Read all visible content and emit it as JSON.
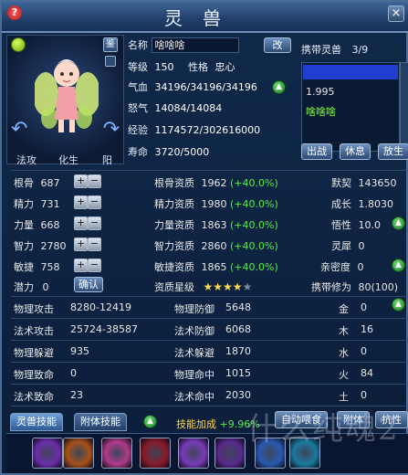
{
  "window": {
    "title": "灵兽"
  },
  "portrait": {
    "jian": "鉴",
    "labels": [
      "法攻",
      "化生",
      "阳"
    ]
  },
  "info": {
    "name_label": "名称",
    "name": "啥啥啥",
    "rename": "改",
    "level_label": "等级",
    "level": "150",
    "personality_label": "性格",
    "personality": "忠心",
    "hp_label": "气血",
    "hp": "34196/34196/34196",
    "rage_label": "怒气",
    "rage": "14084/14084",
    "exp_label": "经验",
    "exp": "1174572/302616000",
    "life_label": "寿命",
    "life": "3720/5000"
  },
  "carry": {
    "label": "携带灵兽",
    "count": "3/9",
    "items": [
      "1.995",
      "啥啥啥"
    ],
    "buttons": {
      "fight": "出战",
      "rest": "休息",
      "release": "放生"
    }
  },
  "stats": {
    "left": [
      {
        "label": "根骨",
        "value": "687"
      },
      {
        "label": "精力",
        "value": "731"
      },
      {
        "label": "力量",
        "value": "668"
      },
      {
        "label": "智力",
        "value": "2780"
      },
      {
        "label": "敏捷",
        "value": "758"
      }
    ],
    "aptitude": [
      {
        "label": "根骨资质",
        "value": "1962",
        "bonus": "(+40.0%)"
      },
      {
        "label": "精力资质",
        "value": "1980",
        "bonus": "(+40.0%)"
      },
      {
        "label": "力量资质",
        "value": "1863",
        "bonus": "(+40.0%)"
      },
      {
        "label": "智力资质",
        "value": "2860",
        "bonus": "(+40.0%)"
      },
      {
        "label": "敏捷资质",
        "value": "1865",
        "bonus": "(+40.0%)"
      }
    ],
    "right": [
      {
        "label": "默契",
        "value": "143650"
      },
      {
        "label": "成长",
        "value": "1.8030"
      },
      {
        "label": "悟性",
        "value": "10.0"
      },
      {
        "label": "灵犀",
        "value": "0"
      },
      {
        "label": "亲密度",
        "value": "0"
      }
    ],
    "potential_label": "潜力",
    "potential": "0",
    "confirm": "确认",
    "star_label": "资质星级",
    "stars": 3.5,
    "stars_total": 5,
    "cultivation_label": "携带修为",
    "cultivation": "80(100)",
    "combat": [
      {
        "label": "物理攻击",
        "value": "8280-12419"
      },
      {
        "label": "法术攻击",
        "value": "25724-38587"
      },
      {
        "label": "物理躲避",
        "value": "935"
      },
      {
        "label": "物理致命",
        "value": "0"
      },
      {
        "label": "法术致命",
        "value": "23"
      }
    ],
    "defense": [
      {
        "label": "物理防御",
        "value": "5648"
      },
      {
        "label": "法术防御",
        "value": "6068"
      },
      {
        "label": "法术躲避",
        "value": "1870"
      },
      {
        "label": "物理命中",
        "value": "1015"
      },
      {
        "label": "法术命中",
        "value": "2030"
      }
    ],
    "elements": [
      {
        "label": "金",
        "value": "0"
      },
      {
        "label": "木",
        "value": "16"
      },
      {
        "label": "水",
        "value": "0"
      },
      {
        "label": "火",
        "value": "84"
      },
      {
        "label": "土",
        "value": "0"
      }
    ]
  },
  "tabs": {
    "skill_tab": "灵兽技能",
    "attach_tab": "附体技能",
    "skill_bonus_label": "技能加成",
    "skill_bonus": "+9.96%",
    "auto_feed": "自动喂食",
    "attach": "附体",
    "resist": "抗性"
  },
  "skills": [
    {
      "icon": "purple-vortex-icon",
      "color": "#6b2fa8"
    },
    {
      "icon": "fire-eye-icon",
      "color": "#a8501a"
    },
    {
      "icon": "pink-flame-icon",
      "color": "#b23a8a"
    },
    {
      "icon": "crimson-swirl-icon",
      "color": "#8a1a2a"
    },
    {
      "icon": "violet-burst-icon",
      "color": "#7a3ab8"
    },
    {
      "icon": "dark-claw-icon",
      "color": "#5a2a8a"
    },
    {
      "icon": "blue-orb-icon",
      "color": "#2a5ab0"
    },
    {
      "icon": "cyan-spark-icon",
      "color": "#1a7aa0"
    }
  ],
  "watermark": "什么纯魂2"
}
